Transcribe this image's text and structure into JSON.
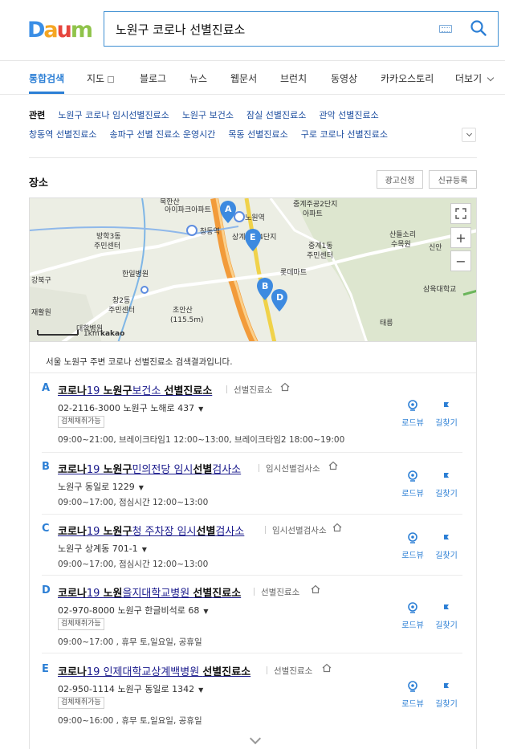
{
  "brand": {
    "logo_letters": [
      "D",
      "a",
      "u",
      "m"
    ],
    "logo_colors": [
      "#3a8ee6",
      "#f5a623",
      "#e6453d",
      "#8fc34a"
    ]
  },
  "search": {
    "query": "노원구 코로나 선별진료소"
  },
  "nav": {
    "tabs": [
      "통합검색",
      "지도",
      "블로그",
      "뉴스",
      "웹문서",
      "브런치",
      "동영상",
      "카카오스토리",
      "더보기"
    ],
    "active_color": "#2c7fd5"
  },
  "related": {
    "title": "관련",
    "row1": [
      "노원구 코로나 임시선별진료소",
      "노원구 보건소",
      "잠실 선별진료소",
      "관악 선별진료소"
    ],
    "row2": [
      "창동역 선별진료소",
      "송파구 선별 진료소 운영시간",
      "목동 선별진료소",
      "구로 코로나 선별진료소"
    ]
  },
  "place": {
    "title": "장소",
    "ad_button": "광고신청",
    "register_button": "신규등록"
  },
  "map": {
    "labels": [
      "북한산",
      "아이파크아파트",
      "중계주공2단지",
      "아파트",
      "방학3동",
      "주민센터",
      "노원역",
      "창동역",
      "상계주공4단지",
      "산들소리",
      "수목원",
      "신안",
      "중계1동",
      "주민센터",
      "롯데마트",
      "한일병원",
      "강북구",
      "창2동",
      "주민센터",
      "초안산",
      "(115.5m)",
      "삼육대학교",
      "태릉",
      "재활원",
      "대학병원",
      "1km",
      "kakao"
    ],
    "markers": [
      "A",
      "E",
      "B",
      "D"
    ]
  },
  "results": {
    "caption": "서울 노원구 주변 코로나 선별진료소 검색결과입니다.",
    "roadview_label": "로드뷰",
    "directions_label": "길찾기",
    "items": [
      {
        "letter": "A",
        "title_parts": [
          "코로나",
          "19 ",
          "노원구",
          "보건소 ",
          "선별진료소"
        ],
        "category": "선별진료소",
        "phone": "02-2116-3000",
        "address": "노원구 노해로 437",
        "badge": "검체채취가능",
        "hours": "09:00~21:00, 브레이크타임1 12:00~13:00, 브레이크타임2 18:00~19:00"
      },
      {
        "letter": "B",
        "title_parts": [
          "코로나",
          "19 ",
          "노원구",
          "민의전당 임시",
          "선별",
          "검사소"
        ],
        "category": "임시선별검사소",
        "phone": "",
        "address": "노원구 동일로 1229",
        "badge": "",
        "hours": "09:00~17:00, 점심시간 12:00~13:00"
      },
      {
        "letter": "C",
        "title_parts": [
          "코로나",
          "19 ",
          "노원구",
          "청 주차장 임시",
          "선별",
          "검사소"
        ],
        "category": "임시선별검사소",
        "phone": "",
        "address": "노원구 상계동 701-1",
        "badge": "",
        "hours": "09:00~17:00, 점심시간 12:00~13:00"
      },
      {
        "letter": "D",
        "title_parts": [
          "코로나",
          "19 ",
          "노원",
          "을지대학교병원 ",
          "선별진료소"
        ],
        "category": "선별진료소",
        "phone": "02-970-8000",
        "address": "노원구 한글비석로 68",
        "badge": "검체채취가능",
        "hours": "09:00~17:00 , 휴무 토,일요일, 공휴일"
      },
      {
        "letter": "E",
        "title_parts": [
          "코로나",
          "19 인제대학교상계백병원 ",
          "선별진료소"
        ],
        "category": "선별진료소",
        "phone": "02-950-1114",
        "address": "노원구 동일로 1342",
        "badge": "검체채취가능",
        "hours": "09:00~16:00 , 휴무 토,일요일, 공휴일"
      }
    ]
  }
}
